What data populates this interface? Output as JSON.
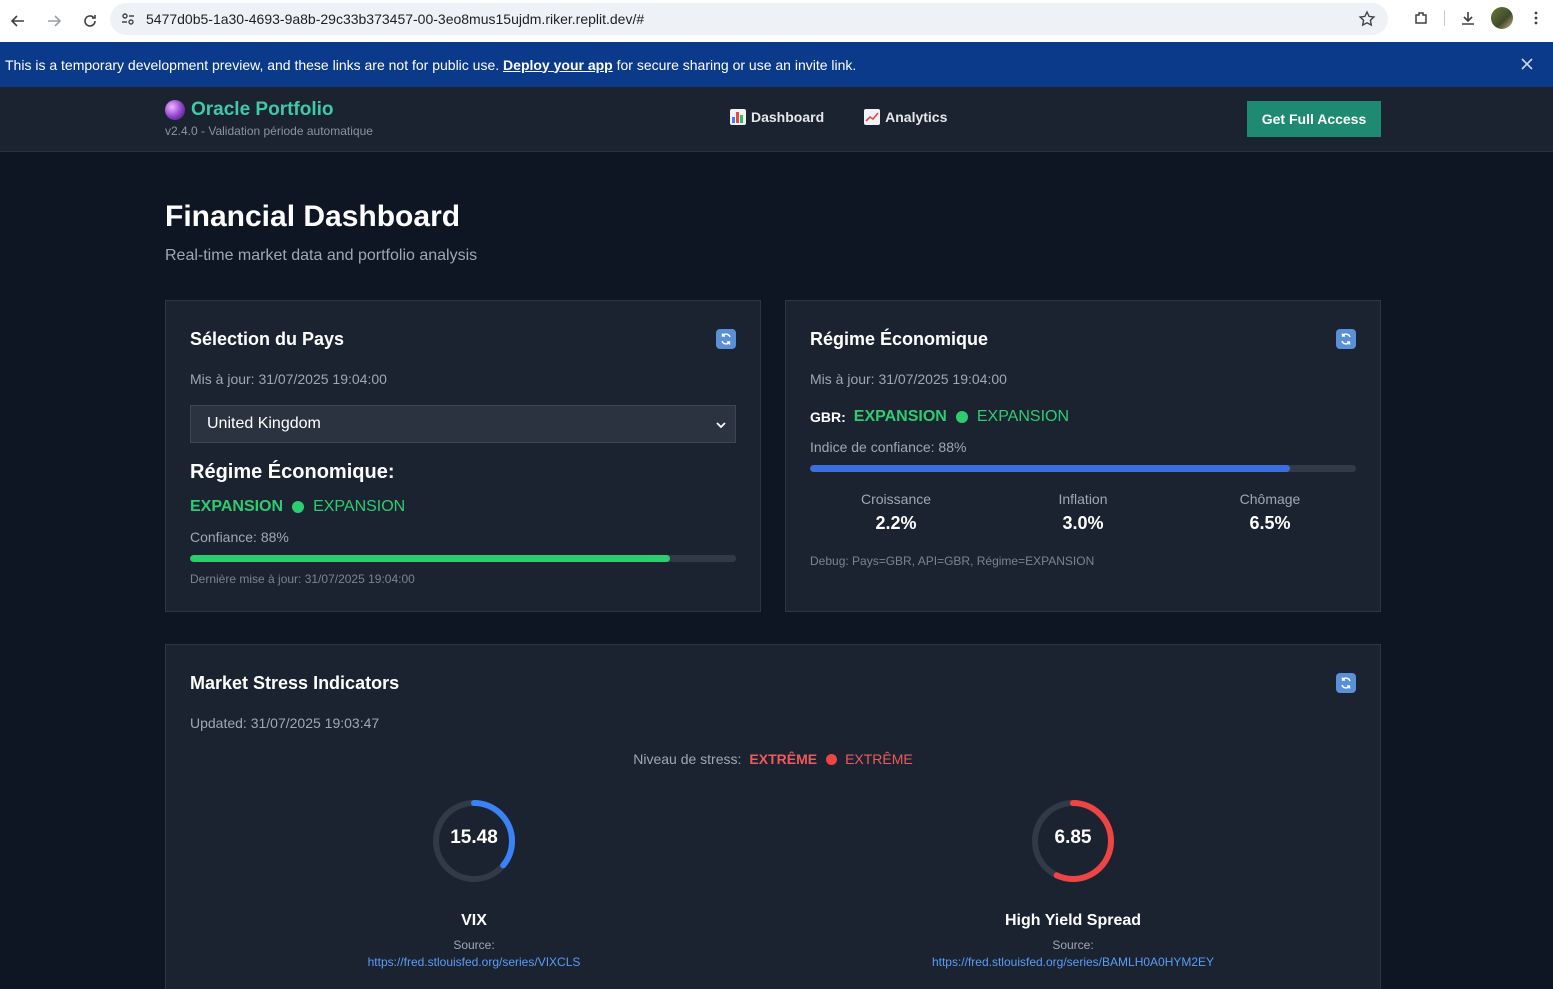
{
  "browser": {
    "url": "5477d0b5-1a30-4693-9a8b-29c33b373457-00-3eo8mus15ujdm.riker.replit.dev/#"
  },
  "banner": {
    "text_before": "This is a temporary development preview, and these links are not for public use.",
    "link": "Deploy your app",
    "text_after": "for secure sharing or use an invite link."
  },
  "header": {
    "brand": "Oracle Portfolio",
    "version": "v2.4.0 - Validation période automatique",
    "nav": [
      {
        "label": "Dashboard",
        "icon": "bar-chart-icon"
      },
      {
        "label": "Analytics",
        "icon": "line-chart-icon"
      }
    ],
    "cta": "Get Full Access"
  },
  "page": {
    "title": "Financial Dashboard",
    "subtitle": "Real-time market data and portfolio analysis"
  },
  "country_card": {
    "title": "Sélection du Pays",
    "updated": "Mis à jour: 31/07/2025 19:04:00",
    "selected_country": "United Kingdom",
    "regime_heading": "Régime Économique:",
    "regime_strong": "EXPANSION",
    "regime_plain": "EXPANSION",
    "confidence_label": "Confiance: 88%",
    "confidence": 0.88,
    "last_update": "Dernière mise à jour: 31/07/2025 19:04:00"
  },
  "regime_card": {
    "title": "Régime Économique",
    "updated": "Mis à jour: 31/07/2025 19:04:00",
    "code": "GBR:",
    "regime_strong": "EXPANSION",
    "regime_plain": "EXPANSION",
    "confidence_label": "Indice de confiance: 88%",
    "confidence": 0.88,
    "stats": [
      {
        "label": "Croissance",
        "value": "2.2%"
      },
      {
        "label": "Inflation",
        "value": "3.0%"
      },
      {
        "label": "Chômage",
        "value": "6.5%"
      }
    ],
    "debug": "Debug: Pays=GBR, API=GBR, Régime=EXPANSION"
  },
  "stress_card": {
    "title": "Market Stress Indicators",
    "updated": "Updated: 31/07/2025 19:03:47",
    "level_label": "Niveau de stress:",
    "level_strong": "EXTRÊME",
    "level_plain": "EXTRÊME",
    "indicators": [
      {
        "name": "VIX",
        "value": "15.48",
        "source_label": "Source:",
        "source_url": "https://fred.stlouisfed.org/series/VIXCLS",
        "fill": 0.36,
        "color": "#3b82f6"
      },
      {
        "name": "High Yield Spread",
        "value": "6.85",
        "source_label": "Source:",
        "source_url": "https://fred.stlouisfed.org/series/BAMLH0A0HYM2EY",
        "fill": 0.57,
        "color": "#ef4444"
      }
    ]
  },
  "colors": {
    "accent_green": "#2ecc71",
    "accent_blue": "#3b6fe0",
    "danger": "#ef4444",
    "brand_teal": "#3fc9a6"
  }
}
